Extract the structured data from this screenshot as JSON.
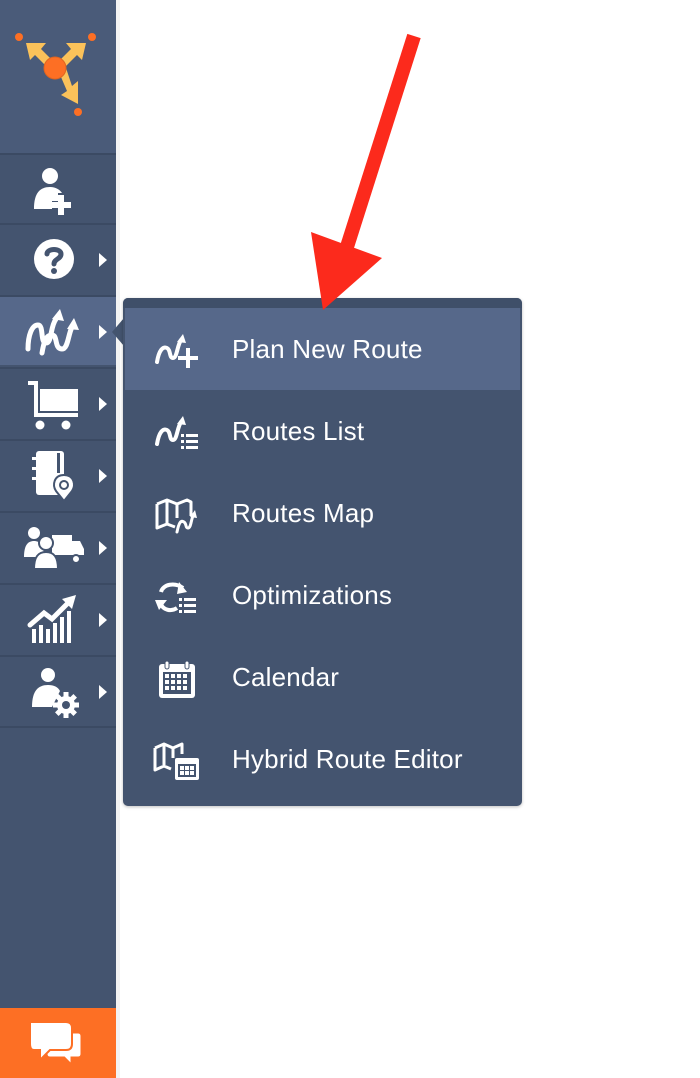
{
  "app": {
    "brand_colors": {
      "sidebar": "#44546f",
      "active": "#56688a",
      "accent": "#fd6f24",
      "logo_arrow": "#fbc25a",
      "annotation": "#fc2a1c"
    },
    "logo": {
      "icon": "route-optimizer-logo-icon"
    }
  },
  "sidebar": {
    "items": [
      {
        "name": "add-user",
        "icon": "add-user-icon",
        "has_submenu": false,
        "active": false
      },
      {
        "name": "help",
        "icon": "question-circle-icon",
        "has_submenu": true,
        "active": false
      },
      {
        "name": "routes",
        "icon": "routes-icon",
        "has_submenu": true,
        "active": true
      },
      {
        "name": "orders",
        "icon": "shopping-cart-icon",
        "has_submenu": true,
        "active": false
      },
      {
        "name": "address-book",
        "icon": "address-book-pin-icon",
        "has_submenu": true,
        "active": false
      },
      {
        "name": "team-vehicles",
        "icon": "team-truck-icon",
        "has_submenu": true,
        "active": false
      },
      {
        "name": "analytics",
        "icon": "chart-trend-icon",
        "has_submenu": true,
        "active": false
      },
      {
        "name": "user-settings",
        "icon": "user-gear-icon",
        "has_submenu": true,
        "active": false
      }
    ],
    "chat": {
      "icon": "chat-bubbles-icon"
    }
  },
  "flyout": {
    "items": [
      {
        "label": "Plan New Route",
        "icon": "plan-route-plus-icon",
        "active": true
      },
      {
        "label": "Routes List",
        "icon": "routes-list-icon",
        "active": false
      },
      {
        "label": "Routes Map",
        "icon": "routes-map-icon",
        "active": false
      },
      {
        "label": "Optimizations",
        "icon": "optimizations-icon",
        "active": false
      },
      {
        "label": "Calendar",
        "icon": "calendar-icon",
        "active": false
      },
      {
        "label": "Hybrid Route Editor",
        "icon": "hybrid-route-editor-icon",
        "active": false
      }
    ]
  },
  "annotation": {
    "type": "red-arrow",
    "points_to": "Plan New Route"
  }
}
